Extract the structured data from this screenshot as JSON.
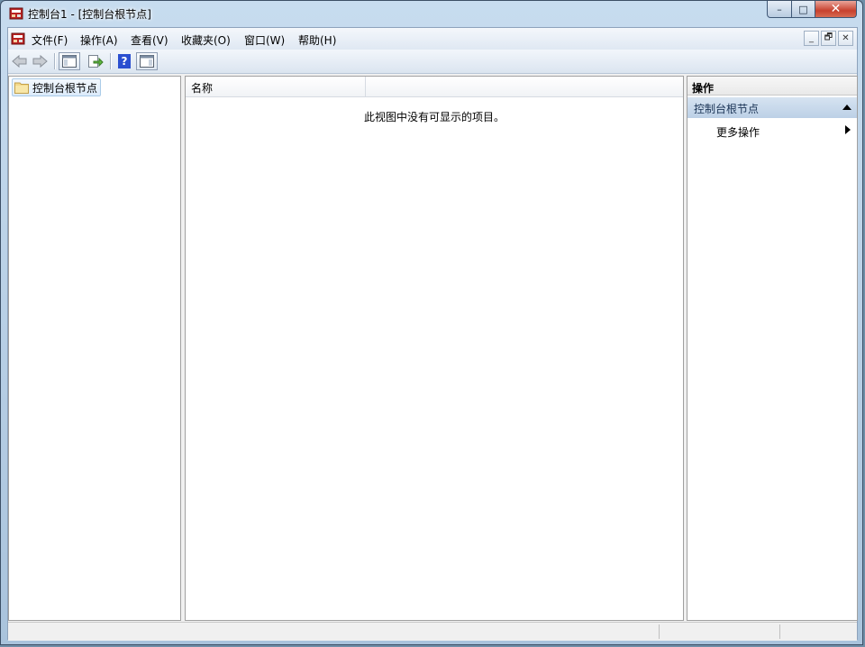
{
  "window": {
    "title": "控制台1 - [控制台根节点]",
    "buttons": {
      "minimize": "–",
      "maximize": "□",
      "close": "✕"
    }
  },
  "menu": {
    "items": [
      "文件(F)",
      "操作(A)",
      "查看(V)",
      "收藏夹(O)",
      "窗口(W)",
      "帮助(H)"
    ],
    "mdi": {
      "minimize": "_",
      "restore": "🗗",
      "close": "✕"
    }
  },
  "toolbar": {
    "icons": [
      "back-arrow-icon",
      "forward-arrow-icon",
      "show-hide-tree-icon",
      "export-list-icon",
      "help-icon",
      "show-hide-action-pane-icon"
    ],
    "help_glyph": "?"
  },
  "tree": {
    "root_label": "控制台根节点"
  },
  "list": {
    "columns": [
      "名称"
    ],
    "empty_message": "此视图中没有可显示的项目。"
  },
  "actions": {
    "title": "操作",
    "group_label": "控制台根节点",
    "items": [
      "更多操作"
    ]
  },
  "colors": {
    "titlebar": "#b9d1ea",
    "close_button": "#c7412e",
    "action_group_bg": "#c8d9ec",
    "selected_node_border": "#aacbe8"
  }
}
